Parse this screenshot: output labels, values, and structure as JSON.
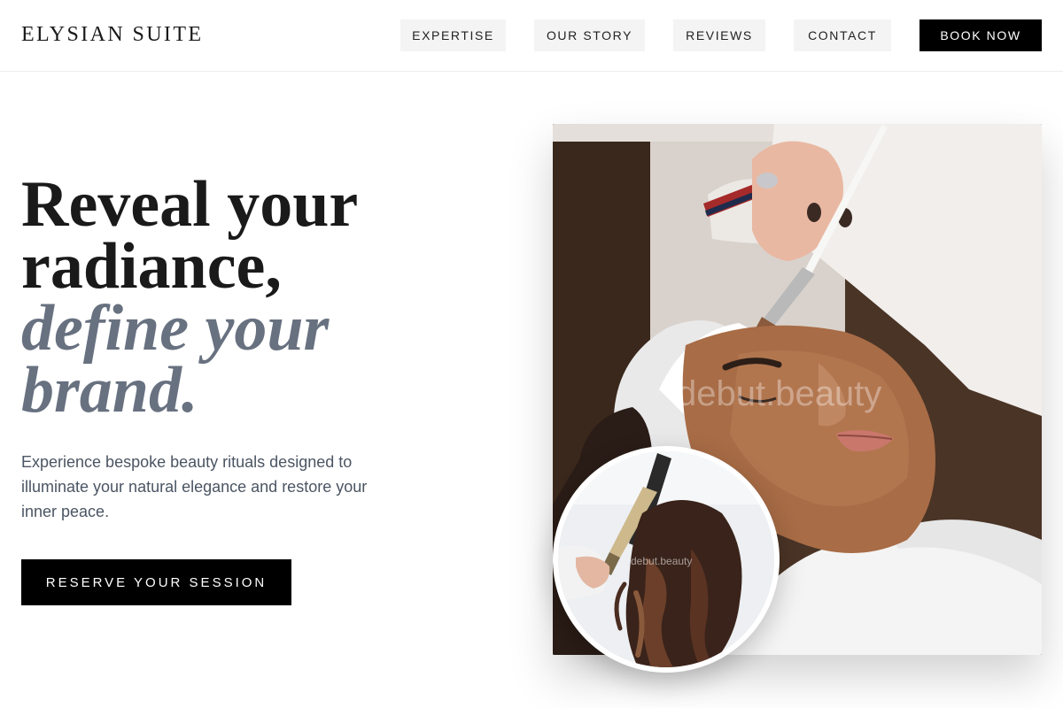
{
  "header": {
    "brand": "ELYSIAN SUITE",
    "nav": [
      {
        "label": "EXPERTISE"
      },
      {
        "label": "OUR STORY"
      },
      {
        "label": "REVIEWS"
      },
      {
        "label": "CONTACT"
      }
    ],
    "book_label": "BOOK NOW"
  },
  "hero": {
    "title_line1": "Reveal your",
    "title_line2": "radiance,",
    "title_line3": "define your",
    "title_line4": "brand.",
    "description": "Experience bespoke beauty rituals designed to illuminate your natural elegance and restore your inner peace.",
    "cta_label": "RESERVE YOUR SESSION"
  },
  "images": {
    "main_watermark": "debut.beauty",
    "circle_watermark": "debut.beauty"
  },
  "colors": {
    "accent_text": "#687180",
    "button_bg": "#000000",
    "nav_bg": "#f4f4f4"
  }
}
